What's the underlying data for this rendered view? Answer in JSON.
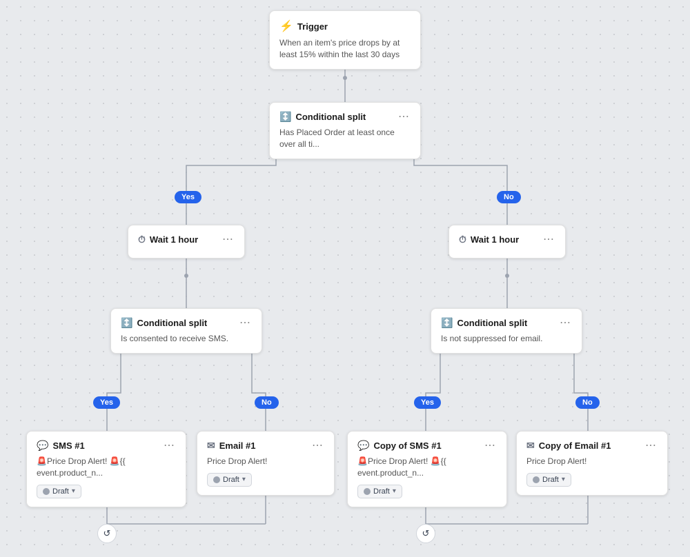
{
  "trigger": {
    "title": "Trigger",
    "description": "When an item's price drops by at least 15% within the last 30 days",
    "icon": "⚡"
  },
  "conditional_split_top": {
    "title": "Conditional split",
    "description": "Has Placed Order at least once over all ti...",
    "icon": "↕"
  },
  "wait_left": {
    "title": "Wait 1 hour",
    "icon": "🕐"
  },
  "wait_right": {
    "title": "Wait 1 hour",
    "icon": "🕐"
  },
  "conditional_split_left": {
    "title": "Conditional split",
    "description": "Is consented to receive SMS.",
    "icon": "↕"
  },
  "conditional_split_right": {
    "title": "Conditional split",
    "description": "Is not suppressed for email.",
    "icon": "↕"
  },
  "badges": {
    "yes_left": "Yes",
    "no_left": "No",
    "yes_right": "Yes",
    "no_right": "No"
  },
  "sms1": {
    "title": "SMS #1",
    "description": "🚨Price Drop Alert! 🚨{{ event.product_n...",
    "draft": "Draft",
    "icon": "💬"
  },
  "email1": {
    "title": "Email #1",
    "description": "Price Drop Alert!",
    "draft": "Draft",
    "icon": "✉"
  },
  "copy_sms1": {
    "title": "Copy of SMS #1",
    "description": "🚨Price Drop Alert! 🚨{{ event.product_n...",
    "draft": "Draft",
    "icon": "💬"
  },
  "copy_email1": {
    "title": "Copy of Email #1",
    "description": "Price Drop Alert!",
    "draft": "Draft",
    "icon": "✉"
  }
}
